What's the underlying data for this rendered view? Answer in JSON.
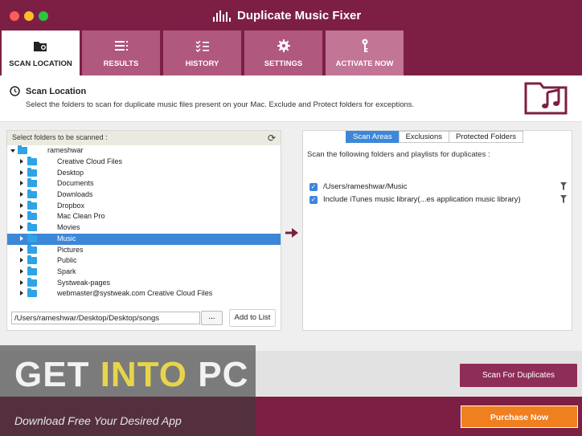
{
  "window": {
    "title": "Duplicate Music Fixer"
  },
  "tabs": [
    {
      "label": "SCAN LOCATION",
      "active": true,
      "icon": "scan-folder-icon"
    },
    {
      "label": "RESULTS",
      "active": false,
      "icon": "list-icon"
    },
    {
      "label": "HISTORY",
      "active": false,
      "icon": "checklist-icon"
    },
    {
      "label": "SETTINGS",
      "active": false,
      "icon": "gear-icon"
    },
    {
      "label": "ACTIVATE NOW",
      "active": false,
      "icon": "key-icon"
    }
  ],
  "header": {
    "title": "Scan Location",
    "subtitle": "Select the folders to scan for duplicate music files present on your Mac. Exclude and Protect folders for exceptions."
  },
  "tree": {
    "heading": "Select folders to be scanned :",
    "root": "rameshwar",
    "items": [
      {
        "label": "Creative Cloud Files",
        "selected": false
      },
      {
        "label": "Desktop",
        "selected": false
      },
      {
        "label": "Documents",
        "selected": false
      },
      {
        "label": "Downloads",
        "selected": false
      },
      {
        "label": "Dropbox",
        "selected": false
      },
      {
        "label": "Mac Clean Pro",
        "selected": false
      },
      {
        "label": "Movies",
        "selected": false
      },
      {
        "label": "Music",
        "selected": true
      },
      {
        "label": "Pictures",
        "selected": false
      },
      {
        "label": "Public",
        "selected": false
      },
      {
        "label": "Spark",
        "selected": false
      },
      {
        "label": "Systweak-pages",
        "selected": false
      },
      {
        "label": "webmaster@systweak.com Creative Cloud Files",
        "selected": false
      }
    ]
  },
  "path_entry": {
    "value": "/Users/rameshwar/Desktop/Desktop/songs",
    "browse_label": "...",
    "add_label": "Add to List"
  },
  "right": {
    "segments": [
      "Scan Areas",
      "Exclusions",
      "Protected Folders"
    ],
    "active_segment": "Scan Areas",
    "description": "Scan the following folders and playlists for duplicates :",
    "items": [
      {
        "label": "/Users/rameshwar/Music",
        "checked": true
      },
      {
        "label": "Include iTunes music library(...es application music library)",
        "checked": true
      }
    ]
  },
  "actions": {
    "scan_label": "Scan For Duplicates",
    "purchase_label": "Purchase Now"
  },
  "watermark": {
    "part1": "GET ",
    "part2": "INTO",
    "part3": " PC",
    "tagline": "Download Free Your Desired App"
  },
  "colors": {
    "brand": "#7d1f45",
    "tab": "#b0587e",
    "accent_blue": "#3d87d9",
    "folder": "#2ea3e6",
    "purchase": "#f07f20"
  }
}
